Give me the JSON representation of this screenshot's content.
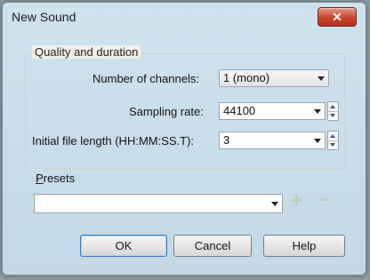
{
  "window": {
    "title": "New Sound",
    "close_glyph": "✕"
  },
  "quality": {
    "legend": "Quality and duration",
    "channels_label": "Number of channels:",
    "channels_value": "1 (mono)",
    "rate_label": "Sampling rate:",
    "rate_value": "44100",
    "length_label": "Initial file length (HH:MM:SS.T):",
    "length_value": "3"
  },
  "presets": {
    "label_prefix": "P",
    "label_rest": "resets",
    "value": ""
  },
  "buttons": {
    "ok": "OK",
    "cancel": "Cancel",
    "help": "Help"
  }
}
